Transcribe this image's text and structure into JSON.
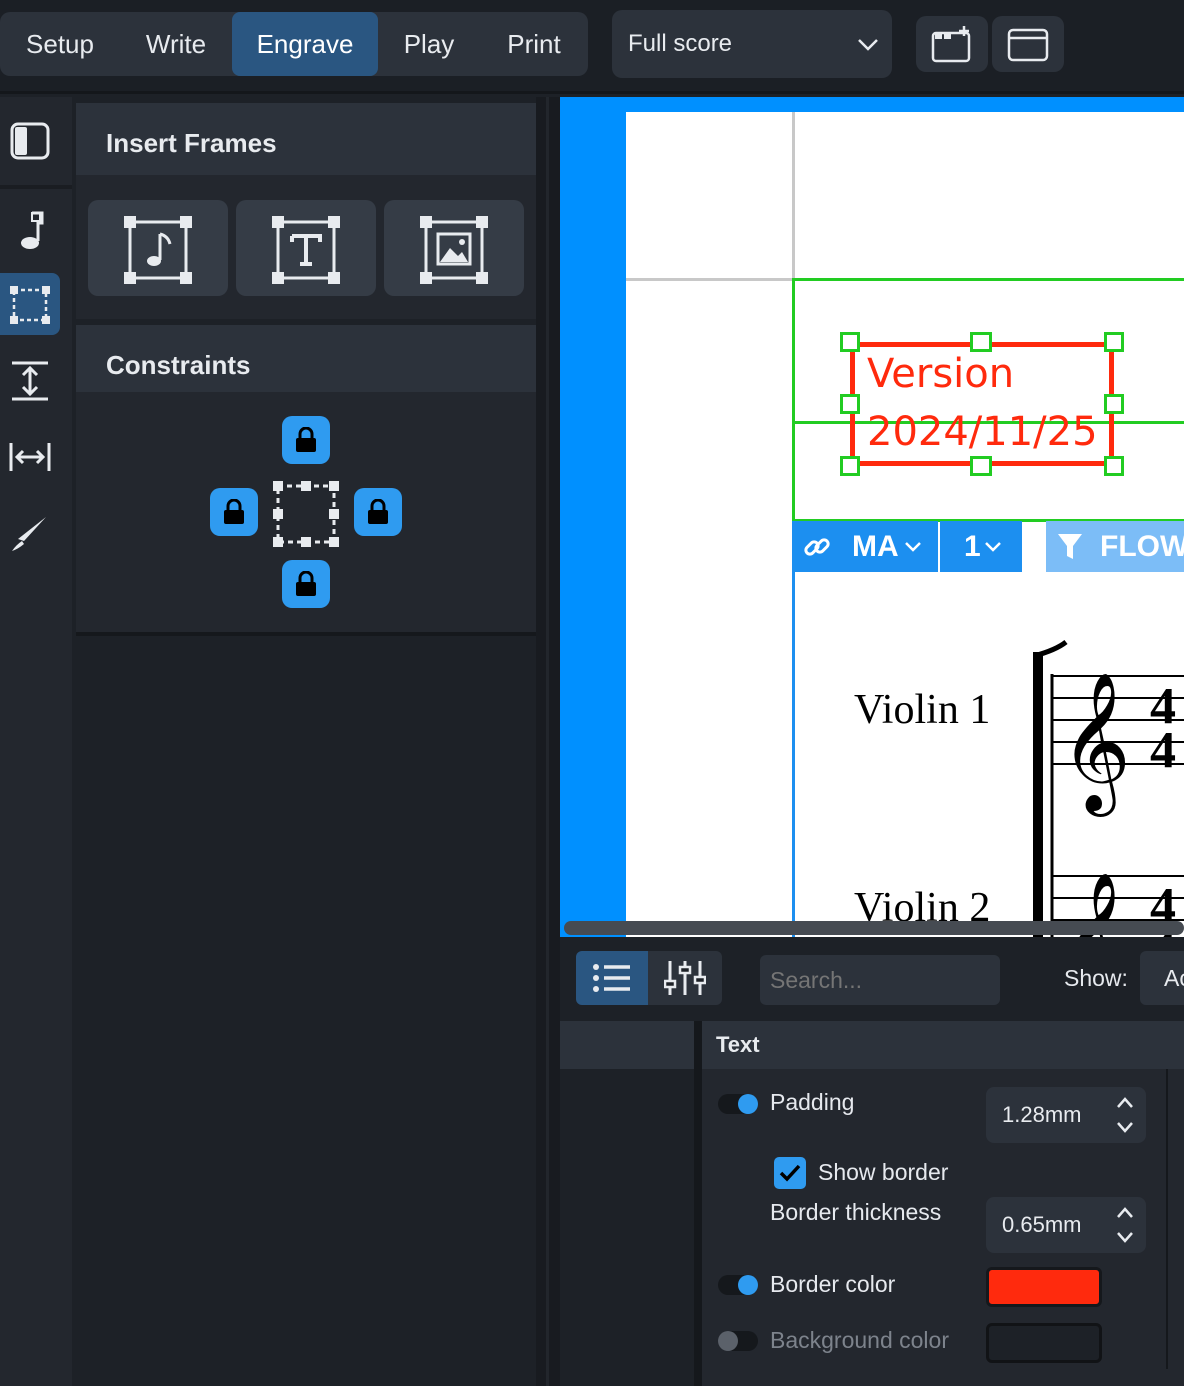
{
  "modes": [
    {
      "label": "Setup",
      "active": false
    },
    {
      "label": "Write",
      "active": false
    },
    {
      "label": "Engrave",
      "active": true
    },
    {
      "label": "Play",
      "active": false
    },
    {
      "label": "Print",
      "active": false
    }
  ],
  "layout_selector": {
    "value": "Full score"
  },
  "toolbar_icons": [
    "new-tab-icon",
    "window-icon"
  ],
  "toolstrip": [
    {
      "name": "left-panel-toggle-icon",
      "active": false
    },
    {
      "name": "note-tool-icon",
      "active": false
    },
    {
      "name": "frame-tool-icon",
      "active": true
    },
    {
      "name": "staff-spacing-icon",
      "active": false
    },
    {
      "name": "note-spacing-icon",
      "active": false
    },
    {
      "name": "graphic-edit-icon",
      "active": false
    }
  ],
  "panel": {
    "insert_frames": {
      "title": "Insert Frames",
      "buttons": [
        "music-frame-icon",
        "text-frame-icon",
        "graphics-frame-icon"
      ]
    },
    "constraints": {
      "title": "Constraints",
      "locks": [
        "top",
        "left",
        "right",
        "bottom"
      ]
    }
  },
  "score": {
    "text_frame": {
      "line1": "Version",
      "line2": "2024/11/25"
    },
    "frame_chain": {
      "master": "MA",
      "chain": "1",
      "filter": "FLOW"
    },
    "staves": [
      "Violin 1",
      "Violin 2"
    ]
  },
  "properties": {
    "search_placeholder": "Search...",
    "show_label": "Show:",
    "show_value": "Act",
    "group": "Text",
    "padding": {
      "label": "Padding",
      "value": "1.28mm",
      "enabled": true
    },
    "show_border": {
      "label": "Show border",
      "checked": true
    },
    "border_thickness": {
      "label": "Border thickness",
      "value": "0.65mm"
    },
    "border_color": {
      "label": "Border color",
      "enabled": true,
      "color": "#ff2a0d"
    },
    "background_color": {
      "label": "Background color",
      "enabled": false
    },
    "colors": {
      "accent": "#2f9bf0",
      "canvas": "#0090ff",
      "frame_selection": "#22cc22",
      "text_frame": "#ff2a0d"
    }
  }
}
